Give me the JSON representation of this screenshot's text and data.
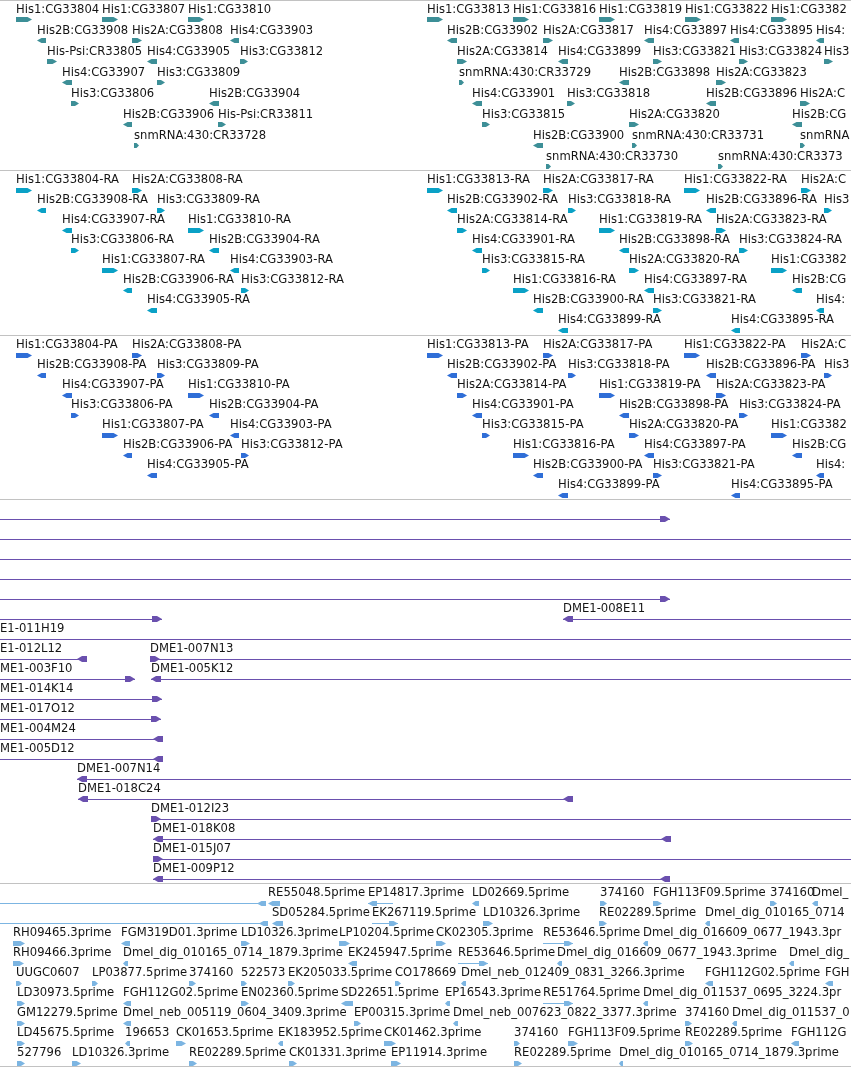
{
  "tracks": [
    {
      "kind": "gene",
      "rows": [
        {
          "features": [
            {
              "label": "His1:CG33804",
              "forward": true
            },
            {
              "label": "His1:CG33807",
              "forward": true
            },
            {
              "label": "His1:CG33810",
              "forward": true
            },
            {
              "label": "His1:CG33813",
              "forward": true
            },
            {
              "label": "His1:CG33816",
              "forward": true
            },
            {
              "label": "His1:CG33819",
              "forward": true
            },
            {
              "label": "His1:CG33822",
              "forward": true
            },
            {
              "label": "His1:CG3382",
              "forward": true
            }
          ]
        },
        {
          "features": [
            {
              "label": "His2B:CG33908",
              "forward": false
            },
            {
              "label": "His2A:CG33808",
              "forward": true
            },
            {
              "label": "His4:CG33903",
              "forward": false
            },
            {
              "label": "His2B:CG33902",
              "forward": false
            },
            {
              "label": "His2A:CG33817",
              "forward": true
            },
            {
              "label": "His4:CG33897",
              "forward": false
            },
            {
              "label": "His4:CG33895",
              "forward": false
            },
            {
              "label": "His4:",
              "forward": false
            }
          ]
        },
        {
          "features": [
            {
              "label": "His-Psi:CR33805",
              "forward": true
            },
            {
              "label": "His4:CG33905",
              "forward": false
            },
            {
              "label": "His3:CG33812",
              "forward": true
            },
            {
              "label": "His2A:CG33814",
              "forward": true
            },
            {
              "label": "His4:CG33899",
              "forward": false
            },
            {
              "label": "His3:CG33821",
              "forward": true
            },
            {
              "label": "His3:CG33824",
              "forward": true
            },
            {
              "label": "His3",
              "forward": true
            }
          ]
        },
        {
          "features": [
            {
              "label": "His4:CG33907",
              "forward": false
            },
            {
              "label": "His3:CG33809",
              "forward": true
            },
            {
              "label": "snmRNA:430:CR33729",
              "forward": true
            },
            {
              "label": "His2B:CG33898",
              "forward": false
            },
            {
              "label": "His2A:CG33823",
              "forward": true
            }
          ]
        },
        {
          "features": [
            {
              "label": "His3:CG33806",
              "forward": true
            },
            {
              "label": "His2B:CG33904",
              "forward": false
            },
            {
              "label": "His4:CG33901",
              "forward": false
            },
            {
              "label": "His3:CG33818",
              "forward": true
            },
            {
              "label": "His2B:CG33896",
              "forward": false
            },
            {
              "label": "His2A:C",
              "forward": true
            }
          ]
        },
        {
          "features": [
            {
              "label": "His2B:CG33906",
              "forward": false
            },
            {
              "label": "His-Psi:CR33811",
              "forward": true
            },
            {
              "label": "His3:CG33815",
              "forward": true
            },
            {
              "label": "His2A:CG33820",
              "forward": true
            },
            {
              "label": "His2B:CG",
              "forward": false
            }
          ]
        },
        {
          "features": [
            {
              "label": "snmRNA:430:CR33728",
              "forward": true
            },
            {
              "label": "His2B:CG33900",
              "forward": false
            },
            {
              "label": "snmRNA:430:CR33731",
              "forward": true
            },
            {
              "label": "snmRNA",
              "forward": true
            }
          ]
        },
        {
          "features": [
            {
              "label": "snmRNA:430:CR33730",
              "forward": true
            },
            {
              "label": "snmRNA:430:CR3373",
              "forward": true
            }
          ]
        }
      ]
    },
    {
      "kind": "transcript",
      "rows": [
        {
          "features": [
            {
              "label": "His1:CG33804-RA",
              "forward": true
            },
            {
              "label": "His2A:CG33808-RA",
              "forward": true
            },
            {
              "label": "His1:CG33813-RA",
              "forward": true
            },
            {
              "label": "His2A:CG33817-RA",
              "forward": true
            },
            {
              "label": "His1:CG33822-RA",
              "forward": true
            },
            {
              "label": "His2A:C",
              "forward": true
            }
          ]
        },
        {
          "features": [
            {
              "label": "His2B:CG33908-RA",
              "forward": false
            },
            {
              "label": "His3:CG33809-RA",
              "forward": true
            },
            {
              "label": "His2B:CG33902-RA",
              "forward": false
            },
            {
              "label": "His3:CG33818-RA",
              "forward": true
            },
            {
              "label": "His2B:CG33896-RA",
              "forward": false
            },
            {
              "label": "His3",
              "forward": true
            }
          ]
        },
        {
          "features": [
            {
              "label": "His4:CG33907-RA",
              "forward": false
            },
            {
              "label": "His1:CG33810-RA",
              "forward": true
            },
            {
              "label": "His2A:CG33814-RA",
              "forward": true
            },
            {
              "label": "His1:CG33819-RA",
              "forward": true
            },
            {
              "label": "His2A:CG33823-RA",
              "forward": true
            }
          ]
        },
        {
          "features": [
            {
              "label": "His3:CG33806-RA",
              "forward": true
            },
            {
              "label": "His2B:CG33904-RA",
              "forward": false
            },
            {
              "label": "His4:CG33901-RA",
              "forward": false
            },
            {
              "label": "His2B:CG33898-RA",
              "forward": false
            },
            {
              "label": "His3:CG33824-RA",
              "forward": true
            }
          ]
        },
        {
          "features": [
            {
              "label": "His1:CG33807-RA",
              "forward": true
            },
            {
              "label": "His4:CG33903-RA",
              "forward": false
            },
            {
              "label": "His3:CG33815-RA",
              "forward": true
            },
            {
              "label": "His2A:CG33820-RA",
              "forward": true
            },
            {
              "label": "His1:CG3382",
              "forward": true
            }
          ]
        },
        {
          "features": [
            {
              "label": "His2B:CG33906-RA",
              "forward": false
            },
            {
              "label": "His3:CG33812-RA",
              "forward": true
            },
            {
              "label": "His1:CG33816-RA",
              "forward": true
            },
            {
              "label": "His4:CG33897-RA",
              "forward": false
            },
            {
              "label": "His2B:CG",
              "forward": false
            }
          ]
        },
        {
          "features": [
            {
              "label": "His4:CG33905-RA",
              "forward": false
            },
            {
              "label": "His2B:CG33900-RA",
              "forward": false
            },
            {
              "label": "His3:CG33821-RA",
              "forward": true
            },
            {
              "label": "His4:",
              "forward": false
            }
          ]
        },
        {
          "features": [
            {
              "label": "His4:CG33899-RA",
              "forward": false
            },
            {
              "label": "His4:CG33895-RA",
              "forward": false
            }
          ]
        }
      ]
    },
    {
      "kind": "protein",
      "rows": [
        {
          "features": [
            {
              "label": "His1:CG33804-PA",
              "forward": true
            },
            {
              "label": "His2A:CG33808-PA",
              "forward": true
            },
            {
              "label": "His1:CG33813-PA",
              "forward": true
            },
            {
              "label": "His2A:CG33817-PA",
              "forward": true
            },
            {
              "label": "His1:CG33822-PA",
              "forward": true
            },
            {
              "label": "His2A:C",
              "forward": true
            }
          ]
        },
        {
          "features": [
            {
              "label": "His2B:CG33908-PA",
              "forward": false
            },
            {
              "label": "His3:CG33809-PA",
              "forward": true
            },
            {
              "label": "His2B:CG33902-PA",
              "forward": false
            },
            {
              "label": "His3:CG33818-PA",
              "forward": true
            },
            {
              "label": "His2B:CG33896-PA",
              "forward": false
            },
            {
              "label": "His3",
              "forward": true
            }
          ]
        },
        {
          "features": [
            {
              "label": "His4:CG33907-PA",
              "forward": false
            },
            {
              "label": "His1:CG33810-PA",
              "forward": true
            },
            {
              "label": "His2A:CG33814-PA",
              "forward": true
            },
            {
              "label": "His1:CG33819-PA",
              "forward": true
            },
            {
              "label": "His2A:CG33823-PA",
              "forward": true
            }
          ]
        },
        {
          "features": [
            {
              "label": "His3:CG33806-PA",
              "forward": true
            },
            {
              "label": "His2B:CG33904-PA",
              "forward": false
            },
            {
              "label": "His4:CG33901-PA",
              "forward": false
            },
            {
              "label": "His2B:CG33898-PA",
              "forward": false
            },
            {
              "label": "His3:CG33824-PA",
              "forward": true
            }
          ]
        },
        {
          "features": [
            {
              "label": "His1:CG33807-PA",
              "forward": true
            },
            {
              "label": "His4:CG33903-PA",
              "forward": false
            },
            {
              "label": "His3:CG33815-PA",
              "forward": true
            },
            {
              "label": "His2A:CG33820-PA",
              "forward": true
            },
            {
              "label": "His1:CG3382",
              "forward": true
            }
          ]
        },
        {
          "features": [
            {
              "label": "His2B:CG33906-PA",
              "forward": false
            },
            {
              "label": "His3:CG33812-PA",
              "forward": true
            },
            {
              "label": "His1:CG33816-PA",
              "forward": true
            },
            {
              "label": "His4:CG33897-PA",
              "forward": false
            },
            {
              "label": "His2B:CG",
              "forward": false
            }
          ]
        },
        {
          "features": [
            {
              "label": "His4:CG33905-PA",
              "forward": false
            },
            {
              "label": "His2B:CG33900-PA",
              "forward": false
            },
            {
              "label": "His3:CG33821-PA",
              "forward": true
            },
            {
              "label": "His4:",
              "forward": false
            }
          ]
        },
        {
          "features": [
            {
              "label": "His4:CG33899-PA",
              "forward": false
            },
            {
              "label": "His4:CG33895-PA",
              "forward": false
            }
          ]
        }
      ]
    },
    {
      "kind": "clone",
      "rows": [
        {
          "features": [
            {
              "kind": "clone",
              "forward": true
            }
          ]
        },
        {
          "features": [
            {
              "kind": "span"
            }
          ]
        },
        {
          "features": [
            {
              "kind": "span"
            }
          ]
        },
        {
          "features": [
            {
              "kind": "span"
            }
          ]
        },
        {
          "features": [
            {
              "kind": "clone",
              "forward": true
            }
          ]
        },
        {
          "features": [
            {
              "kind": "clone",
              "forward": true
            },
            {
              "label": "DME1-008E11",
              "kind": "clone",
              "forward": false
            }
          ]
        },
        {
          "features": [
            {
              "label": "E1-011H19",
              "kind": "span"
            }
          ]
        },
        {
          "features": [
            {
              "label": "E1-012L12",
              "kind": "clone",
              "forward": false
            },
            {
              "label": "DME1-007N13",
              "kind": "clone",
              "forward": true
            }
          ]
        },
        {
          "features": [
            {
              "label": "ME1-003F10",
              "kind": "clone",
              "forward": true
            },
            {
              "label": "DME1-005K12",
              "kind": "clone",
              "forward": false
            }
          ]
        },
        {
          "features": [
            {
              "label": "ME1-014K14",
              "kind": "clone",
              "forward": true
            }
          ]
        },
        {
          "features": [
            {
              "label": "ME1-017O12",
              "kind": "clone",
              "forward": true
            }
          ]
        },
        {
          "features": [
            {
              "label": "ME1-004M24",
              "kind": "clone",
              "forward": false
            }
          ]
        },
        {
          "features": [
            {
              "label": "ME1-005D12",
              "kind": "clone",
              "forward": false
            }
          ]
        },
        {
          "features": [
            {
              "label": "DME1-007N14",
              "kind": "clone",
              "forward": false
            }
          ]
        },
        {
          "features": [
            {
              "label": "DME1-018C24",
              "kind": "clone",
              "forward": false
            }
          ]
        },
        {
          "features": [
            {
              "label": "DME1-012I23",
              "kind": "clone",
              "forward": true
            }
          ]
        },
        {
          "features": [
            {
              "label": "DME1-018K08",
              "kind": "clone",
              "forward": false
            }
          ]
        },
        {
          "features": [
            {
              "label": "DME1-015J07",
              "kind": "clone",
              "forward": true
            }
          ]
        },
        {
          "features": [
            {
              "label": "DME1-009P12",
              "kind": "clone",
              "forward": false
            }
          ]
        }
      ]
    },
    {
      "kind": "est",
      "rows": [
        {
          "features": [
            {
              "forward": false
            },
            {
              "label": "RE55048.5prime",
              "forward": false
            },
            {
              "label": "EP14817.3prime",
              "forward": false
            },
            {
              "label": "LD02669.5prime",
              "forward": false
            },
            {
              "label": "374160",
              "forward": true
            },
            {
              "label": "FGH113F09.5prime",
              "forward": true
            },
            {
              "label": "374160",
              "forward": true
            },
            {
              "label": "Dmel_",
              "forward": false
            }
          ]
        },
        {
          "features": [
            {
              "forward": false
            },
            {
              "label": "SD05284.5prime",
              "forward": false
            },
            {
              "label": "EK267119.5prime",
              "forward": true
            },
            {
              "label": "LD10326.3prime",
              "forward": true
            },
            {
              "label": "RE02289.5prime",
              "forward": true
            },
            {
              "label": "Dmel_dig_010165_0714",
              "forward": false
            }
          ]
        },
        {
          "features": [
            {
              "label": "RH09465.3prime",
              "forward": true
            },
            {
              "label": "FGM319D01.3prime",
              "forward": false
            },
            {
              "label": "LD10326.3prime",
              "forward": true
            },
            {
              "label": "LP10204.5prime",
              "forward": true
            },
            {
              "label": "CK02305.3prime",
              "forward": true
            },
            {
              "label": "RE53646.5prime",
              "forward": true
            },
            {
              "label": "Dmel_dig_016609_0677_1943.3pr",
              "forward": false
            }
          ]
        },
        {
          "features": [
            {
              "label": "RH09466.3prime",
              "forward": true
            },
            {
              "label": "Dmel_dig_010165_0714_1879.3prime",
              "forward": false
            },
            {
              "label": "EK245947.5prime",
              "forward": false
            },
            {
              "label": "RE53646.5prime",
              "forward": true
            },
            {
              "label": "Dmel_dig_016609_0677_1943.3prime",
              "forward": false
            },
            {
              "label": "Dmel_dig_",
              "forward": false
            }
          ]
        },
        {
          "features": [
            {
              "label": "UUGC0607",
              "forward": true
            },
            {
              "label": "LP03877.5prime",
              "forward": true
            },
            {
              "label": "374160",
              "forward": true
            },
            {
              "label": "522573",
              "forward": true
            },
            {
              "label": "EK205033.5prime",
              "forward": true
            },
            {
              "label": "CO178669",
              "forward": true
            },
            {
              "label": "Dmel_neb_012409_0831_3266.3prime",
              "forward": false
            },
            {
              "label": "FGH112G02.5prime",
              "forward": false
            },
            {
              "label": "FGH",
              "forward": false
            }
          ]
        },
        {
          "features": [
            {
              "label": "LD30973.5prime",
              "forward": true
            },
            {
              "label": "FGH112G02.5prime",
              "forward": false
            },
            {
              "label": "EN02360.5prime",
              "forward": true
            },
            {
              "label": "SD22651.5prime",
              "forward": false
            },
            {
              "label": "EP16543.3prime",
              "forward": false
            },
            {
              "label": "RE51764.5prime",
              "forward": true
            },
            {
              "label": "Dmel_dig_011537_0695_3224.3pr",
              "forward": false
            }
          ]
        },
        {
          "features": [
            {
              "label": "GM12279.5prime",
              "forward": true
            },
            {
              "label": "Dmel_neb_005119_0604_3409.3prime",
              "forward": false
            },
            {
              "label": "EP00315.3prime",
              "forward": true
            },
            {
              "label": "Dmel_neb_007623_0822_3377.3prime",
              "forward": false
            },
            {
              "label": "374160",
              "forward": true
            },
            {
              "label": "Dmel_dig_011537_0",
              "forward": false
            }
          ]
        },
        {
          "features": [
            {
              "label": "LD45675.5prime",
              "forward": true
            },
            {
              "label": "196653",
              "forward": false
            },
            {
              "label": "CK01653.5prime",
              "forward": true
            },
            {
              "label": "EK183952.5prime",
              "forward": false
            },
            {
              "label": "CK01462.3prime",
              "forward": true
            },
            {
              "label": "374160",
              "forward": true
            },
            {
              "label": "FGH113F09.5prime",
              "forward": true
            },
            {
              "label": "RE02289.5prime",
              "forward": true
            },
            {
              "label": "FGH112G",
              "forward": false
            }
          ]
        },
        {
          "features": [
            {
              "label": "527796",
              "forward": true
            },
            {
              "label": "LD10326.3prime",
              "forward": true
            },
            {
              "label": "RE02289.5prime",
              "forward": true
            },
            {
              "label": "CK01331.3prime",
              "forward": true
            },
            {
              "label": "EP11914.3prime",
              "forward": true
            },
            {
              "label": "RE02289.5prime",
              "forward": true
            },
            {
              "label": "Dmel_dig_010165_0714_1879.3prime",
              "forward": false
            }
          ]
        }
      ]
    }
  ]
}
